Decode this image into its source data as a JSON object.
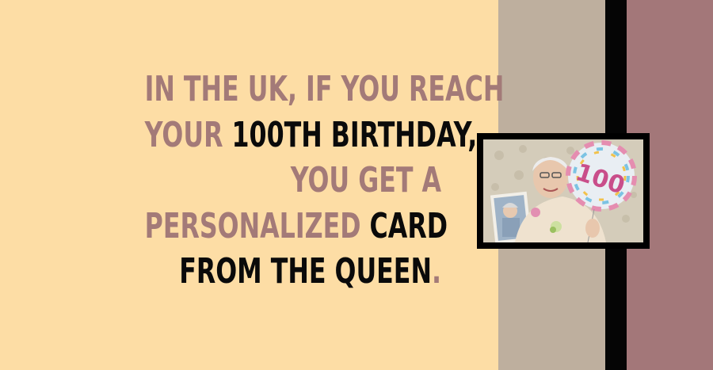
{
  "headline": {
    "line1": "IN THE UK, IF YOU REACH",
    "line2_a": "YOUR",
    "line2_b": "100TH BIRTHDAY",
    "line2_c": ",",
    "line3": "YOU GET A",
    "line4_a": "PERSONALIZED",
    "line4_b": "CARD",
    "line5_a": "FROM THE QUEEN",
    "line5_b": "."
  },
  "photo": {
    "balloon_text": "100"
  },
  "colors": {
    "background_left": "#FDDDA5",
    "band_tan": "#BEAF9E",
    "band_black": "#050505",
    "band_mauve": "#A37779",
    "text_mauve": "#A37A78",
    "text_dark": "#0A0A0A"
  }
}
